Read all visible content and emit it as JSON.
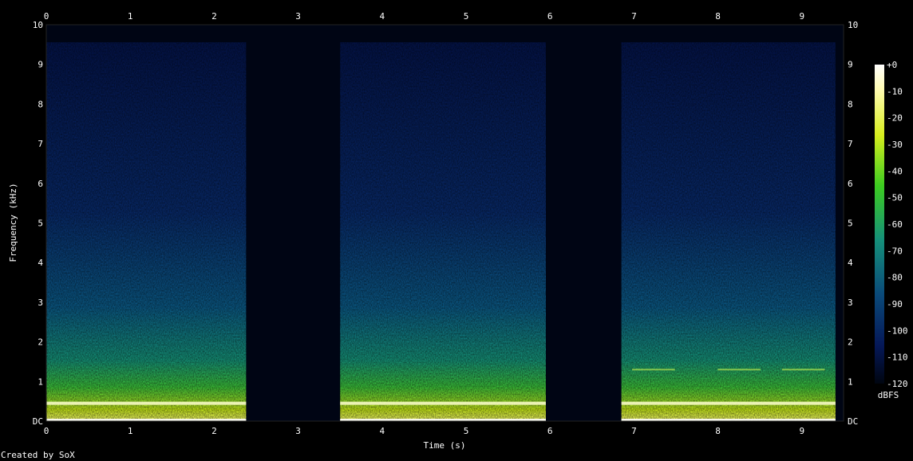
{
  "chart_data": {
    "type": "heatmap",
    "xlabel": "Time (s)",
    "ylabel": "Frequency (kHz)",
    "xlim": [
      0,
      9.45
    ],
    "ylim": [
      0,
      10
    ],
    "x_ticks": [
      "0",
      "1",
      "2",
      "3",
      "4",
      "5",
      "6",
      "7",
      "8",
      "9"
    ],
    "y_ticks": [
      "DC",
      "1",
      "2",
      "3",
      "4",
      "5",
      "6",
      "7",
      "8",
      "9",
      "10"
    ],
    "colorbar": {
      "label": "dBFS",
      "ticks": [
        "+0",
        "-10",
        "-20",
        "-30",
        "-40",
        "-50",
        "-60",
        "-70",
        "-80",
        "-90",
        "-100",
        "-110",
        "-120"
      ],
      "range_db": [
        -120,
        0
      ]
    },
    "segments": [
      {
        "start_s": 0.0,
        "end_s": 2.38,
        "tone_khz": 0.45
      },
      {
        "start_s": 3.5,
        "end_s": 5.95,
        "tone_khz": 0.45
      },
      {
        "start_s": 6.85,
        "end_s": 9.4,
        "tone_khz": 0.45,
        "harmonic_khz": 1.3
      }
    ],
    "colors": {
      "background": "#000000",
      "low": "#000a2e",
      "mid": "#0a5a8a",
      "high": "#3ccc30",
      "peak": "#ffffd0"
    }
  },
  "footer": "Created by SoX"
}
